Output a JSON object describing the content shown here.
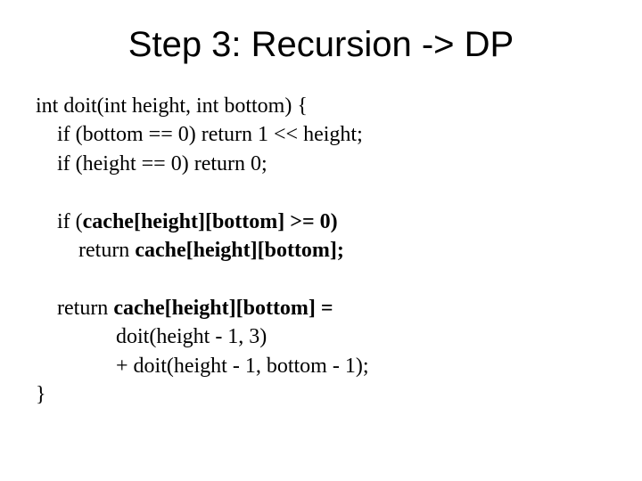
{
  "title": "Step 3: Recursion -> DP",
  "code": {
    "l1": "int doit(int height, int bottom) {",
    "l2": "    if (bottom == 0) return 1 << height;",
    "l3": "    if (height == 0) return 0;",
    "l5a": "    if (",
    "l5b": "cache[height][bottom] >= 0)",
    "l6a": "        return ",
    "l6b": "cache[height][bottom];",
    "l8a": "    return ",
    "l8b": "cache[height][bottom] =",
    "l9": "               doit(height - 1, 3)",
    "l10": "               + doit(height - 1, bottom - 1);",
    "l11": "}"
  }
}
